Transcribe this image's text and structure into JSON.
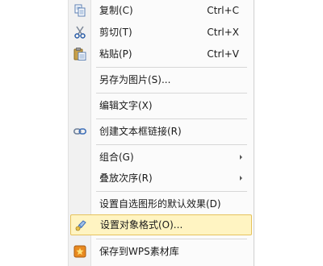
{
  "menu": {
    "items": [
      {
        "label": "复制(C)",
        "shortcut": "Ctrl+C",
        "icon": "copy-icon"
      },
      {
        "label": "剪切(T)",
        "shortcut": "Ctrl+X",
        "icon": "scissors-icon"
      },
      {
        "label": "粘贴(P)",
        "shortcut": "Ctrl+V",
        "icon": "paste-icon"
      },
      {
        "label": "另存为图片(S)..."
      },
      {
        "label": "编辑文字(X)"
      },
      {
        "label": "创建文本框链接(R)",
        "icon": "link-icon"
      },
      {
        "label": "组合(G)",
        "submenu": true
      },
      {
        "label": "叠放次序(R)",
        "submenu": true
      },
      {
        "label": "设置自选图形的默认效果(D)"
      },
      {
        "label": "设置对象格式(O)...",
        "icon": "format-object-icon",
        "highlighted": true
      },
      {
        "label": "保存到WPS素材库",
        "icon": "wps-library-icon"
      }
    ]
  },
  "colors": {
    "highlight_bg": "#fff4c2",
    "highlight_border": "#e6c25c",
    "separator": "#d7d7d7"
  }
}
